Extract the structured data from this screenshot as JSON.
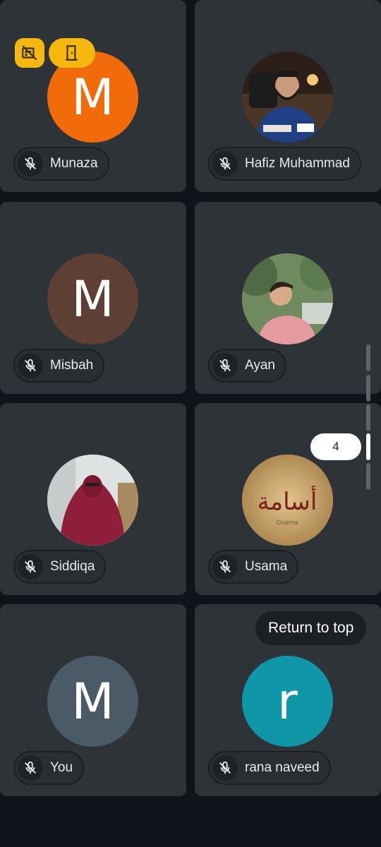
{
  "participants": [
    {
      "name": "Munaza",
      "initial": "M",
      "avatar_color": "#f26b0a",
      "muted": true
    },
    {
      "name": "Hafiz Muhammad",
      "initial": "",
      "avatar_color": "#3b2a1f",
      "muted": true
    },
    {
      "name": "Misbah",
      "initial": "M",
      "avatar_color": "#5d3f34",
      "muted": true
    },
    {
      "name": "Ayan",
      "initial": "",
      "avatar_color": "#7a8f6b",
      "muted": true
    },
    {
      "name": "Siddiqa",
      "initial": "",
      "avatar_color": "#d9dcdf",
      "muted": true
    },
    {
      "name": "Usama",
      "initial": "",
      "avatar_color": "#c9a46a",
      "muted": true
    },
    {
      "name": "You",
      "initial": "M",
      "avatar_color": "#4a5a66",
      "muted": true
    },
    {
      "name": "rana naveed",
      "initial": "r",
      "avatar_color": "#0f97a8",
      "muted": true
    }
  ],
  "usama_logo": {
    "arabic": "أسامة",
    "latin": "Osama"
  },
  "page_indicator": "4",
  "return_to_top_label": "Return to top",
  "colors": {
    "badge": "#f6b80e",
    "tile": "#2e3338",
    "background": "#0f141a"
  },
  "badges": [
    "no-video-icon",
    "door-exit-icon"
  ]
}
